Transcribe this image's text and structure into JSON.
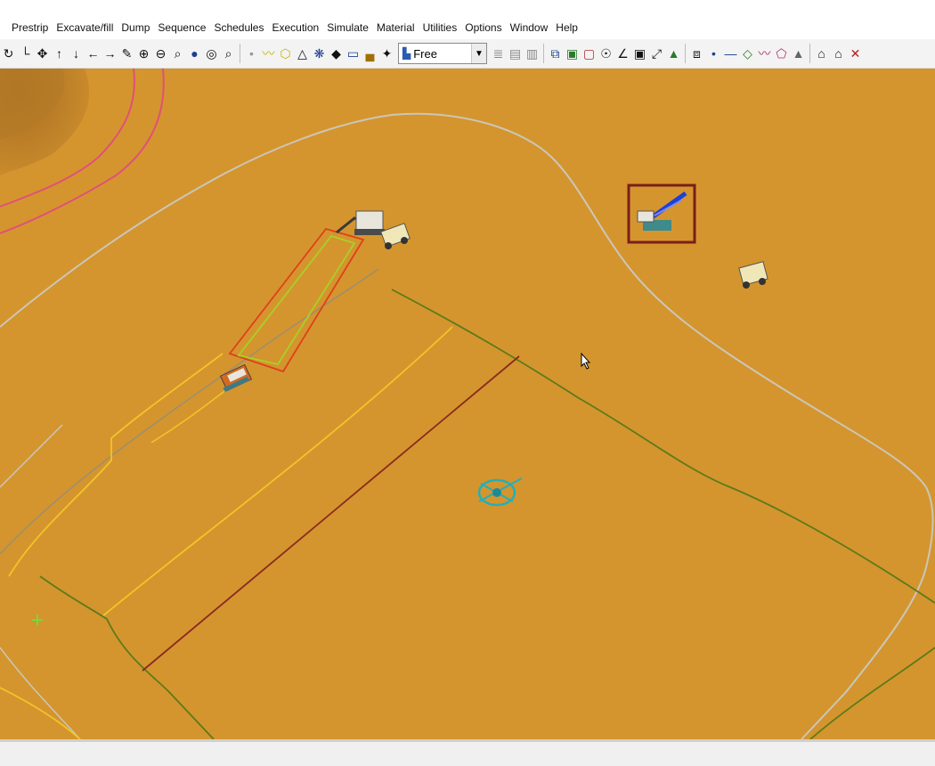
{
  "menu": {
    "items": [
      "Prestrip",
      "Excavate/fill",
      "Dump",
      "Sequence",
      "Schedules",
      "Execution",
      "Simulate",
      "Material",
      "Utilities",
      "Options",
      "Window",
      "Help"
    ]
  },
  "toolbar": {
    "view_mode": "Free"
  },
  "colors": {
    "terrain": "#d4952e",
    "selection_box": "#7a1e18",
    "cut_outline": "#e0401a",
    "haul_road": "#f2c428",
    "boundary": "#5c7a1a",
    "contour": "#c9c4b4",
    "dig_line": "#8a2a22"
  },
  "icons": {
    "excavator": "excavator-icon",
    "haul_truck": "haul-truck-icon",
    "dozer": "dozer-icon",
    "dragline": "dragline-icon",
    "compass": "compass-icon",
    "cursor": "mouse-cursor-icon",
    "survey_point": "survey-point-icon"
  }
}
